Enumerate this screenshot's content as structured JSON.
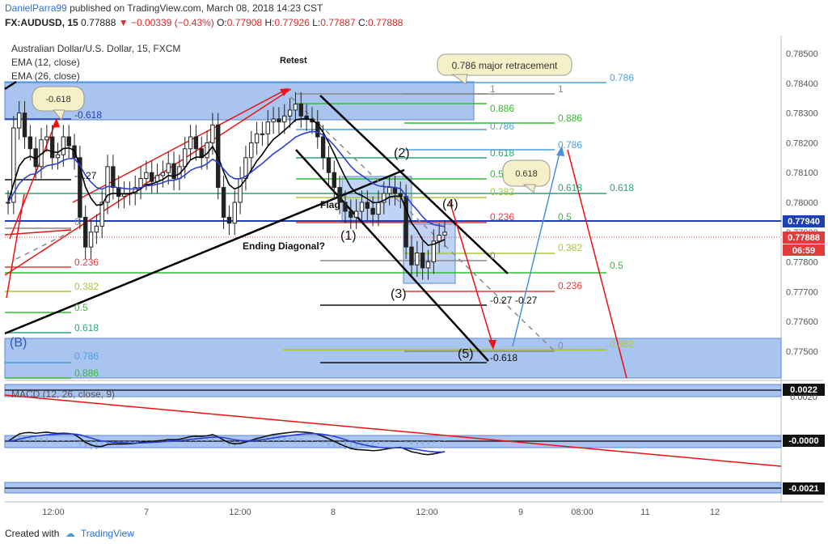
{
  "header": {
    "author": "DanielParra99",
    "published": "published on TradingView.com, March 08, 2018 14:23 CST"
  },
  "symbol_line": {
    "symbol": "FX:AUDUSD, 15",
    "last": "0.77888",
    "change": "−0.00339 (−0.43%)",
    "o_label": "O:",
    "o": "0.77908",
    "h_label": "H:",
    "h": "0.77926",
    "l_label": "L:",
    "l": "0.77887",
    "c_label": "C:",
    "c": "0.77888"
  },
  "legend": {
    "title": "Australian Dollar/U.S. Dollar, 15, FXCM",
    "ema1": "EMA (12, close)",
    "ema2": "EMA (26, close)",
    "macd": "MACD (12, 26, close, 9)"
  },
  "footer": {
    "created_with": "Created with",
    "brand": "TradingView"
  },
  "colors": {
    "blue_zone": "#aac4f0",
    "fib_blue": "#4aa0e0",
    "fib_green": "#26b426",
    "fib_red": "#e23b3b",
    "down_arrow": "#e11",
    "ema_fast": "#000000",
    "ema_slow": "#2b3fd6"
  },
  "chart_data": [
    {
      "type": "line",
      "name": "AUDUSD 15m price",
      "x_ticks": [
        "12:00",
        "7",
        "12:00",
        "8",
        "12:00",
        "9",
        "08:00",
        "11",
        "12"
      ],
      "y_ticks": [
        0.785,
        0.784,
        0.783,
        0.782,
        0.781,
        0.78,
        0.779,
        0.778,
        0.777,
        0.776,
        0.775
      ],
      "ylim": [
        0.7741,
        0.7856
      ],
      "price_close_approx": [
        0.78,
        0.7825,
        0.783,
        0.7822,
        0.7818,
        0.7812,
        0.7821,
        0.7822,
        0.7815,
        0.7816,
        0.7822,
        0.7819,
        0.7815,
        0.7795,
        0.7785,
        0.779,
        0.7792,
        0.78,
        0.7812,
        0.7805,
        0.7802,
        0.7803,
        0.7803,
        0.7805,
        0.7808,
        0.781,
        0.7807,
        0.7809,
        0.781,
        0.7813,
        0.7808,
        0.7812,
        0.7818,
        0.7822,
        0.7818,
        0.7815,
        0.782,
        0.7826,
        0.7805,
        0.7795,
        0.7793,
        0.78,
        0.7808,
        0.7815,
        0.782,
        0.7823,
        0.7823,
        0.7827,
        0.7828,
        0.7827,
        0.7829,
        0.7831,
        0.7833,
        0.7829,
        0.7828,
        0.7827,
        0.7822,
        0.7815,
        0.781,
        0.7805,
        0.78,
        0.7797,
        0.7795,
        0.7797,
        0.78,
        0.7798,
        0.7796,
        0.78,
        0.7803,
        0.7805,
        0.7803,
        0.7802,
        0.7785,
        0.7779,
        0.7783,
        0.7778,
        0.778,
        0.7787,
        0.7789,
        0.779
      ],
      "price_labels": [
        {
          "text": "0.77940",
          "value": 0.7794
        },
        {
          "text": "0.77888",
          "value": 0.77888
        },
        {
          "text": "06:59",
          "value": 0.7786
        }
      ],
      "annotations": {
        "texts": [
          "Retest",
          "Flag",
          "Ending Diagonal?",
          "(1)",
          "(2)",
          "(3)",
          "(4)",
          "(5)",
          "(B)"
        ],
        "callouts": [
          "0.786 major retracement",
          "-0.618",
          "0.618"
        ],
        "fib_left": [
          "-0.618",
          "-0.27",
          "0",
          "0.236",
          "0.382",
          "0.5",
          "0.618",
          "0.786",
          "0.886"
        ],
        "fib_mid": [
          "1",
          "0.886",
          "0.786",
          "0.618",
          "0.5",
          "0.382",
          "0.236",
          "0",
          "-0.27",
          "-0.618"
        ],
        "fib_right": [
          "1",
          "0.886",
          "0.786",
          "0.618",
          "0.5",
          "0.382",
          "0.236",
          "-0.27",
          "0"
        ],
        "fib_far": [
          "0.786",
          "0.786",
          "0.618",
          "0.5",
          "0.382"
        ]
      }
    },
    {
      "type": "line",
      "name": "MACD (12, 26, close, 9)",
      "price_labels": [
        {
          "text": "0.0022"
        },
        {
          "text": "-0.0000"
        },
        {
          "text": "-0.0021"
        }
      ],
      "y_tick": "0.0020"
    }
  ]
}
